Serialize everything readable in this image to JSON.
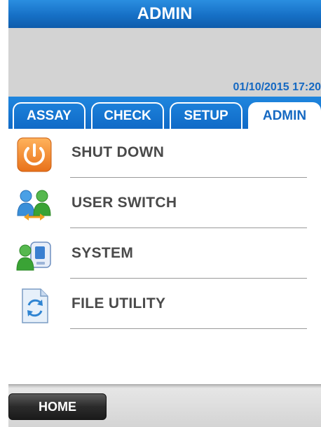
{
  "window": {
    "title": "ADMIN"
  },
  "info": {
    "datetime": "01/10/2015 17:20"
  },
  "tabs": [
    {
      "label": "ASSAY",
      "active": false
    },
    {
      "label": "CHECK",
      "active": false
    },
    {
      "label": "SETUP",
      "active": false
    },
    {
      "label": "ADMIN",
      "active": true
    }
  ],
  "menu": {
    "items": [
      {
        "label": "SHUT DOWN",
        "icon": "power-icon"
      },
      {
        "label": "USER SWITCH",
        "icon": "user-switch-icon"
      },
      {
        "label": "SYSTEM",
        "icon": "system-icon"
      },
      {
        "label": "FILE UTILITY",
        "icon": "file-utility-icon"
      }
    ]
  },
  "footer": {
    "home_label": "HOME"
  },
  "colors": {
    "title_blue": "#1670c6",
    "accent_blue": "#1669c2",
    "power_orange": "#f08a24",
    "user_green": "#3aa335",
    "user_blue": "#2f84d2"
  }
}
